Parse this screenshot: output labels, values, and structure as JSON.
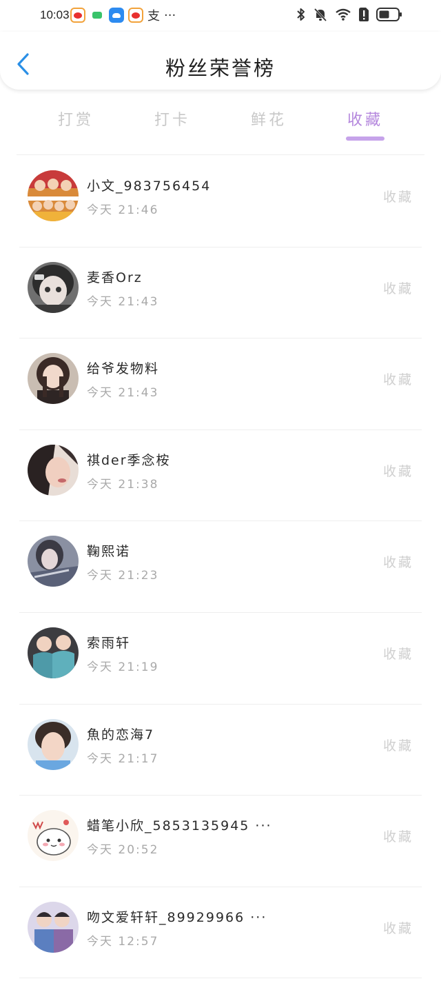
{
  "status_bar": {
    "time": "10:03",
    "apps": [
      "weibo-icon",
      "chat-icon",
      "cloud-icon",
      "weibo-icon"
    ],
    "app_text": "支",
    "more": "···"
  },
  "header": {
    "title": "粉丝荣誉榜"
  },
  "tabs": [
    {
      "label": "打赏",
      "active": false
    },
    {
      "label": "打卡",
      "active": false
    },
    {
      "label": "鲜花",
      "active": false
    },
    {
      "label": "收藏",
      "active": true
    }
  ],
  "list": [
    {
      "name": "小文_983756454",
      "time": "今天 21:46",
      "action": "收藏"
    },
    {
      "name": "麦香Orz",
      "time": "今天 21:43",
      "action": "收藏"
    },
    {
      "name": "给爷发物料",
      "time": "今天 21:43",
      "action": "收藏"
    },
    {
      "name": "祺der季念桉",
      "time": "今天 21:38",
      "action": "收藏"
    },
    {
      "name": "鞠熙诺",
      "time": "今天 21:23",
      "action": "收藏"
    },
    {
      "name": "索雨轩",
      "time": "今天 21:19",
      "action": "收藏"
    },
    {
      "name": "魚的恋海7",
      "time": "今天 21:17",
      "action": "收藏"
    },
    {
      "name": "蜡笔小欣_5853135945 ···",
      "time": "今天 20:52",
      "action": "收藏"
    },
    {
      "name": "吻文爱轩轩_89929966 ···",
      "time": "今天 12:57",
      "action": "收藏"
    }
  ],
  "colors": {
    "accent": "#b487dd",
    "underline": "#c6a3ea",
    "back_arrow": "#2a8fe6",
    "inactive_tab": "#c8c8c8",
    "secondary_text": "#a9a9a9"
  }
}
